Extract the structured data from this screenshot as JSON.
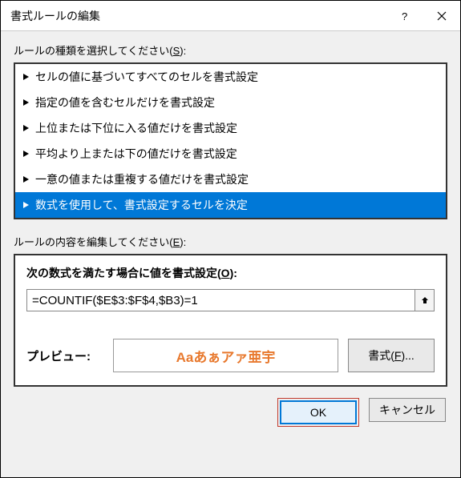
{
  "titlebar": {
    "title": "書式ルールの編集"
  },
  "labels": {
    "ruleType_pre": "ルールの種類を選択してください(",
    "ruleType_u": "S",
    "ruleType_post": "):",
    "ruleContent_pre": "ルールの内容を編集してください(",
    "ruleContent_u": "E",
    "ruleContent_post": "):",
    "formula_pre": "次の数式を満たす場合に値を書式設定(",
    "formula_u": "O",
    "formula_post": "):",
    "preview": "プレビュー:",
    "format_pre": "書式(",
    "format_u": "F",
    "format_post": ")...",
    "ok": "OK",
    "cancel": "キャンセル"
  },
  "ruleTypes": [
    {
      "label": "セルの値に基づいてすべてのセルを書式設定",
      "selected": false
    },
    {
      "label": "指定の値を含むセルだけを書式設定",
      "selected": false
    },
    {
      "label": "上位または下位に入る値だけを書式設定",
      "selected": false
    },
    {
      "label": "平均より上または下の値だけを書式設定",
      "selected": false
    },
    {
      "label": "一意の値または重複する値だけを書式設定",
      "selected": false
    },
    {
      "label": "数式を使用して、書式設定するセルを決定",
      "selected": true
    }
  ],
  "formula": {
    "value": "=COUNTIF($E$3:$F$4,$B3)=1"
  },
  "preview": {
    "sample": "Aaあぁアァ亜宇",
    "color": "#e8792e"
  }
}
